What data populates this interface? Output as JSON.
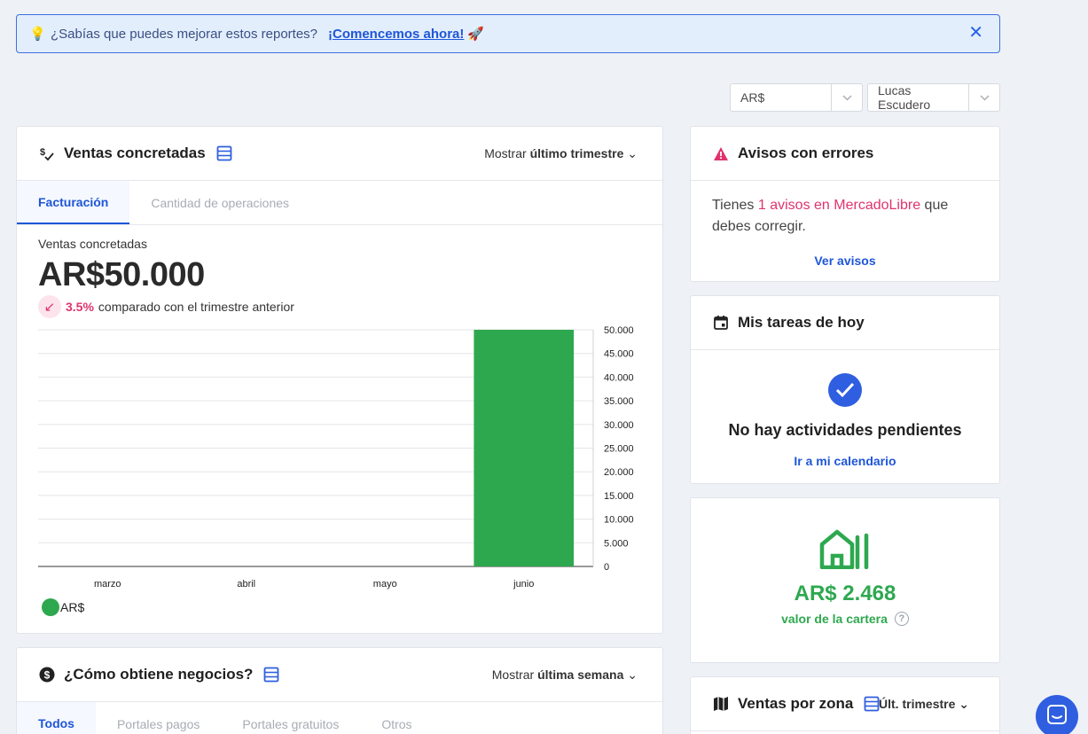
{
  "banner": {
    "question": "¿Sabías que puedes mejorar estos reportes?",
    "cta": "¡Comencemos ahora!",
    "close_icon": "close-icon"
  },
  "filters": {
    "currency": "AR$",
    "user": "Lucas Escudero"
  },
  "sales": {
    "title": "Ventas concretadas",
    "show_prefix": "Mostrar",
    "show_value": "último trimestre",
    "tabs": [
      "Facturación",
      "Cantidad de operaciones"
    ],
    "subtitle": "Ventas concretadas",
    "amount": "AR$50.000",
    "delta_pct": "3.5%",
    "delta_text": "comparado con el trimestre anterior",
    "legend": "AR$"
  },
  "chart_data": {
    "type": "bar",
    "categories": [
      "marzo",
      "abril",
      "mayo",
      "junio"
    ],
    "series": [
      {
        "name": "AR$",
        "values": [
          0,
          0,
          0,
          50000
        ],
        "color": "#2ea84f"
      }
    ],
    "ylim": [
      0,
      50000
    ],
    "yticks": [
      0,
      5000,
      10000,
      15000,
      20000,
      25000,
      30000,
      35000,
      40000,
      45000,
      50000
    ],
    "ytick_labels": [
      "0",
      "5.000",
      "10.000",
      "15.000",
      "20.000",
      "25.000",
      "30.000",
      "35.000",
      "40.000",
      "45.000",
      "50.000"
    ],
    "grid": true,
    "y_axis_side": "right"
  },
  "errors": {
    "title": "Avisos con errores",
    "text_before": "Tienes ",
    "count": "1",
    "highlight": " avisos en MercadoLibre",
    "text_after": " que debes corregir.",
    "link": "Ver avisos"
  },
  "tasks": {
    "title": "Mis tareas de hoy",
    "empty": "No hay actividades pendientes",
    "link": "Ir a mi calendario"
  },
  "portfolio": {
    "value": "AR$ 2.468",
    "label": "valor de la cartera",
    "help": "?"
  },
  "business": {
    "title": "¿Cómo obtiene negocios?",
    "show_prefix": "Mostrar",
    "show_value": "última semana",
    "tabs": [
      "Todos",
      "Portales pagos",
      "Portales gratuitos",
      "Otros"
    ]
  },
  "zone": {
    "title": "Ventas por zona",
    "period": "Últ. trimestre"
  },
  "colors": {
    "accent": "#1e56d8",
    "success": "#2ea84f",
    "alert": "#e0336c"
  }
}
